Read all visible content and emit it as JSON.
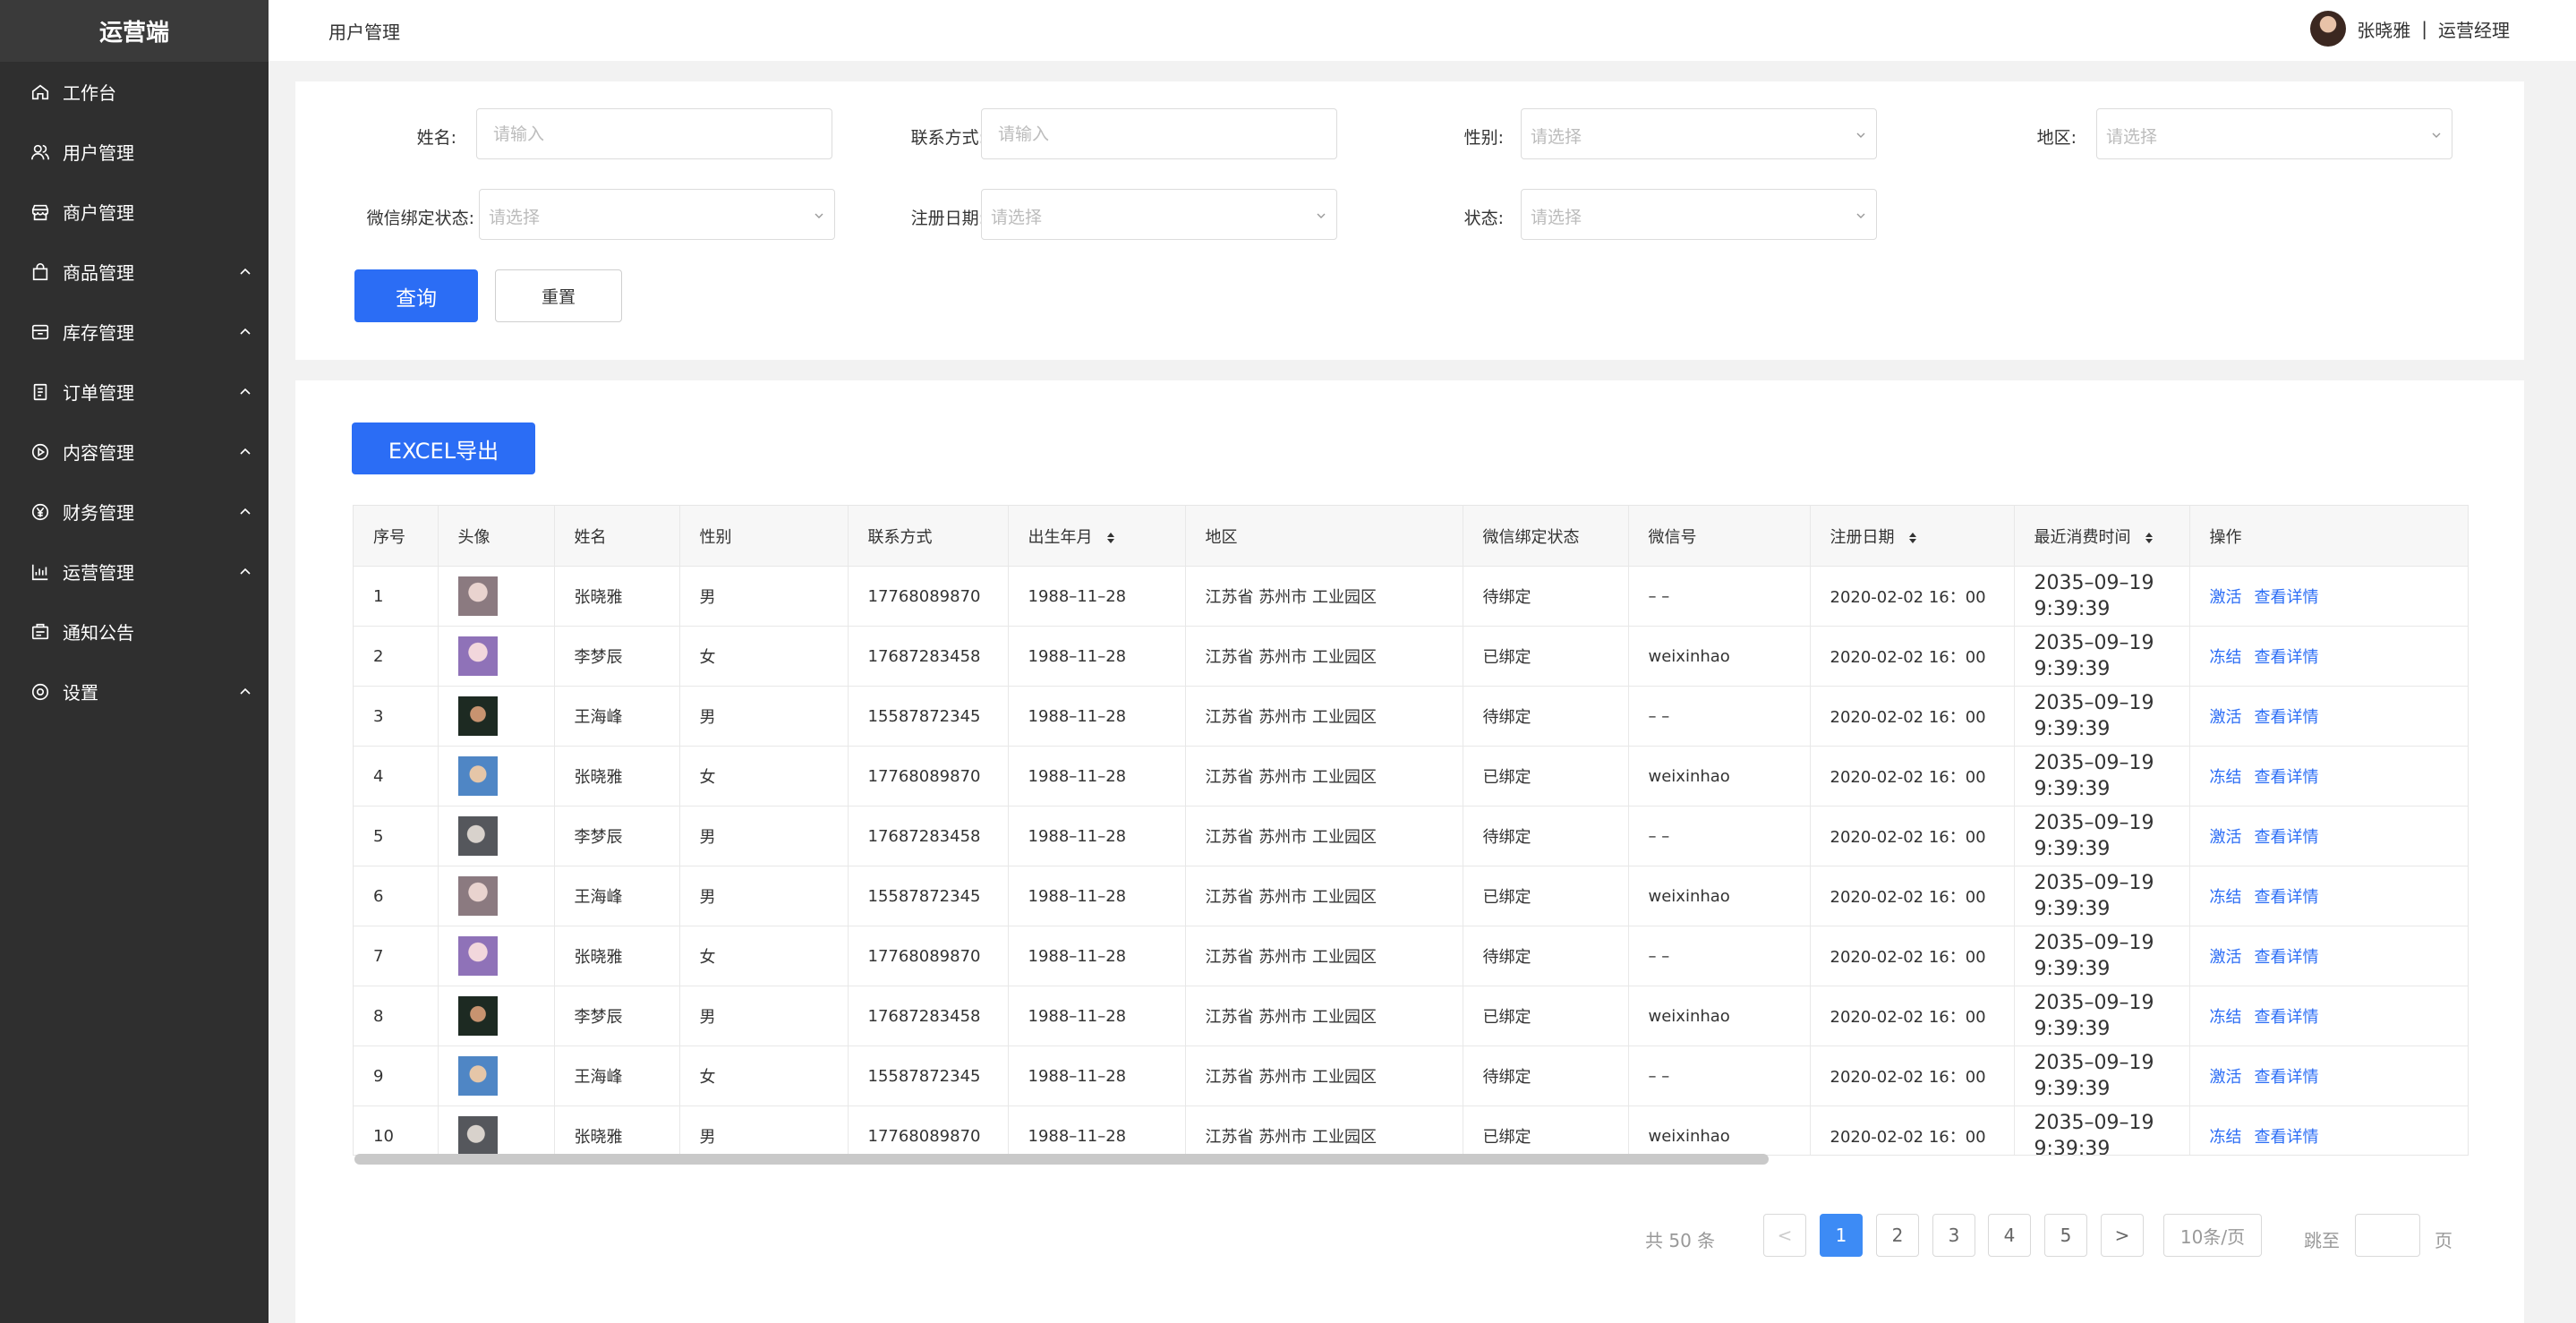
{
  "sidebar": {
    "brand": "运营端",
    "items": [
      {
        "label": "工作台",
        "icon": "home-icon",
        "expandable": false
      },
      {
        "label": "用户管理",
        "icon": "users-icon",
        "expandable": false
      },
      {
        "label": "商户管理",
        "icon": "shop-icon",
        "expandable": false
      },
      {
        "label": "商品管理",
        "icon": "bag-icon",
        "expandable": true
      },
      {
        "label": "库存管理",
        "icon": "box-icon",
        "expandable": true
      },
      {
        "label": "订单管理",
        "icon": "clipboard-icon",
        "expandable": true
      },
      {
        "label": "内容管理",
        "icon": "play-circle-icon",
        "expandable": true
      },
      {
        "label": "财务管理",
        "icon": "yen-circle-icon",
        "expandable": true
      },
      {
        "label": "运营管理",
        "icon": "bar-chart-icon",
        "expandable": true
      },
      {
        "label": "通知公告",
        "icon": "notice-icon",
        "expandable": false
      },
      {
        "label": "设置",
        "icon": "settings-icon",
        "expandable": true
      }
    ]
  },
  "header": {
    "title": "用户管理",
    "user_name": "张晓雅",
    "separator": "|",
    "user_role": "运营经理"
  },
  "filters": {
    "name_label": "姓名:",
    "name_placeholder": "请输入",
    "contact_label": "联系方式:",
    "contact_placeholder": "请输入",
    "gender_label": "性别:",
    "gender_placeholder": "请选择",
    "region_label": "地区:",
    "region_placeholder": "请选择",
    "wechat_label": "微信绑定状态:",
    "wechat_placeholder": "请选择",
    "regdate_label": "注册日期:",
    "regdate_placeholder": "请选择",
    "status_label": "状态:",
    "status_placeholder": "请选择",
    "query_button": "查询",
    "reset_button": "重置"
  },
  "export_button": "EXCEL导出",
  "table": {
    "columns": [
      "序号",
      "头像",
      "姓名",
      "性别",
      "联系方式",
      "出生年月",
      "地区",
      "微信绑定状态",
      "微信号",
      "注册日期",
      "最近消费时间",
      "操作"
    ],
    "rows": [
      {
        "no": "1",
        "name": "张晓雅",
        "gender": "男",
        "phone": "17768089870",
        "birth": "1988–11–28",
        "region": "江苏省 苏州市 工业园区",
        "wechat_status": "待绑定",
        "wechat_id": "– –",
        "reg_date": "2020-02-02 16：00",
        "last_time": "2035–09–19 9:39:39",
        "action1": "激活",
        "action2": "查看详情"
      },
      {
        "no": "2",
        "name": "李梦辰",
        "gender": "女",
        "phone": "17687283458",
        "birth": "1988–11–28",
        "region": "江苏省 苏州市 工业园区",
        "wechat_status": "已绑定",
        "wechat_id": "weixinhao",
        "reg_date": "2020-02-02 16：00",
        "last_time": "2035–09–19 9:39:39",
        "action1": "冻结",
        "action2": "查看详情"
      },
      {
        "no": "3",
        "name": "王海峰",
        "gender": "男",
        "phone": "15587872345",
        "birth": "1988–11–28",
        "region": "江苏省 苏州市 工业园区",
        "wechat_status": "待绑定",
        "wechat_id": "– –",
        "reg_date": "2020-02-02 16：00",
        "last_time": "2035–09–19 9:39:39",
        "action1": "激活",
        "action2": "查看详情"
      },
      {
        "no": "4",
        "name": "张晓雅",
        "gender": "女",
        "phone": "17768089870",
        "birth": "1988–11–28",
        "region": "江苏省 苏州市 工业园区",
        "wechat_status": "已绑定",
        "wechat_id": "weixinhao",
        "reg_date": "2020-02-02 16：00",
        "last_time": "2035–09–19 9:39:39",
        "action1": "冻结",
        "action2": "查看详情"
      },
      {
        "no": "5",
        "name": "李梦辰",
        "gender": "男",
        "phone": "17687283458",
        "birth": "1988–11–28",
        "region": "江苏省 苏州市 工业园区",
        "wechat_status": "待绑定",
        "wechat_id": "– –",
        "reg_date": "2020-02-02 16：00",
        "last_time": "2035–09–19 9:39:39",
        "action1": "激活",
        "action2": "查看详情"
      },
      {
        "no": "6",
        "name": "王海峰",
        "gender": "男",
        "phone": "15587872345",
        "birth": "1988–11–28",
        "region": "江苏省 苏州市 工业园区",
        "wechat_status": "已绑定",
        "wechat_id": "weixinhao",
        "reg_date": "2020-02-02 16：00",
        "last_time": "2035–09–19 9:39:39",
        "action1": "冻结",
        "action2": "查看详情"
      },
      {
        "no": "7",
        "name": "张晓雅",
        "gender": "女",
        "phone": "17768089870",
        "birth": "1988–11–28",
        "region": "江苏省 苏州市 工业园区",
        "wechat_status": "待绑定",
        "wechat_id": "– –",
        "reg_date": "2020-02-02 16：00",
        "last_time": "2035–09–19 9:39:39",
        "action1": "激活",
        "action2": "查看详情"
      },
      {
        "no": "8",
        "name": "李梦辰",
        "gender": "男",
        "phone": "17687283458",
        "birth": "1988–11–28",
        "region": "江苏省 苏州市 工业园区",
        "wechat_status": "已绑定",
        "wechat_id": "weixinhao",
        "reg_date": "2020-02-02 16：00",
        "last_time": "2035–09–19 9:39:39",
        "action1": "冻结",
        "action2": "查看详情"
      },
      {
        "no": "9",
        "name": "王海峰",
        "gender": "女",
        "phone": "15587872345",
        "birth": "1988–11–28",
        "region": "江苏省 苏州市 工业园区",
        "wechat_status": "待绑定",
        "wechat_id": "– –",
        "reg_date": "2020-02-02 16：00",
        "last_time": "2035–09–19 9:39:39",
        "action1": "激活",
        "action2": "查看详情"
      },
      {
        "no": "10",
        "name": "张晓雅",
        "gender": "男",
        "phone": "17768089870",
        "birth": "1988–11–28",
        "region": "江苏省 苏州市 工业园区",
        "wechat_status": "已绑定",
        "wechat_id": "weixinhao",
        "reg_date": "2020-02-02 16：00",
        "last_time": "2035–09–19 9:39:39",
        "action1": "冻结",
        "action2": "查看详情"
      }
    ]
  },
  "pagination": {
    "total": "共 50 条",
    "prev": "<",
    "pages": [
      "1",
      "2",
      "3",
      "4",
      "5"
    ],
    "current": "1",
    "next": ">",
    "page_size": "10条/页",
    "jump_label": "跳至",
    "jump_unit": "页"
  },
  "colors": {
    "accent": "#2b6df5",
    "sidebar_bg": "#2f2f2f",
    "brand_bg": "#3a3a3a",
    "page_bg": "#f2f2f2"
  }
}
